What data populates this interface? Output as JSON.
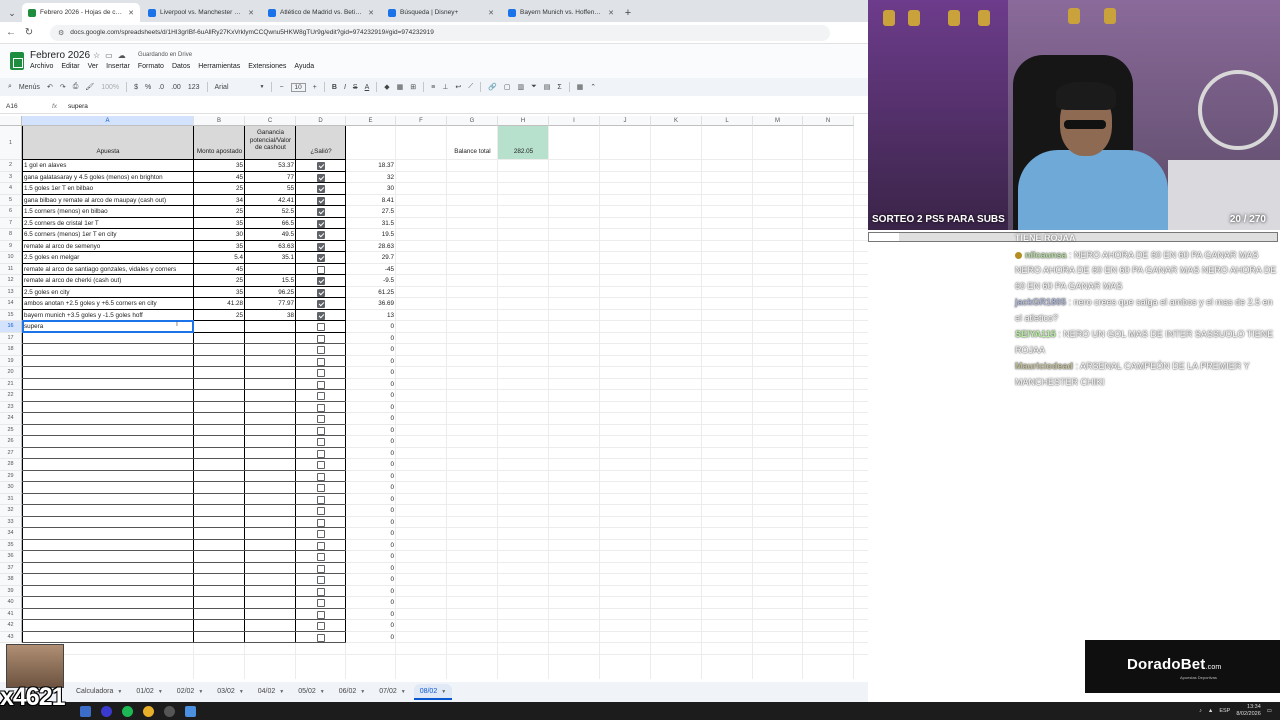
{
  "browser": {
    "tabs": [
      {
        "title": "Febrero 2026 - Hojas de cálcul",
        "active": true,
        "color": "#1e8e3e"
      },
      {
        "title": "Liverpool vs. Manchester City |",
        "active": false,
        "color": "#1a73e8"
      },
      {
        "title": "Atlético de Madrid vs. Betis | D",
        "active": false,
        "color": "#1a73e8"
      },
      {
        "title": "Búsqueda | Disney+",
        "active": false,
        "color": "#1a73e8"
      },
      {
        "title": "Bayern Munich vs. Hoffenheim",
        "active": false,
        "color": "#1a73e8"
      }
    ],
    "url": "docs.google.com/spreadsheets/d/1HI3grIBf-6uAllRy27KxVrklymCCQwnu5HKW8gTUr9g/edit?gid=974232919#gid=974232919"
  },
  "sheets": {
    "title": "Febrero 2026",
    "saved_status": "Guardando en Drive",
    "menu": [
      "Archivo",
      "Editar",
      "Ver",
      "Insertar",
      "Formato",
      "Datos",
      "Herramientas",
      "Extensiones",
      "Ayuda"
    ],
    "toolbar": {
      "menus_label": "Menús",
      "zoom": "100%",
      "currency": "$",
      "percent": "%",
      "decimals_less": ".0",
      "decimals_more": ".00",
      "num_format": "123",
      "font": "Arial",
      "font_size": "10"
    },
    "namebox": "A16",
    "formula": "supera"
  },
  "grid": {
    "columns": [
      "A",
      "B",
      "C",
      "D",
      "E",
      "F",
      "G",
      "H",
      "I",
      "J",
      "K",
      "L",
      "M",
      "N"
    ],
    "header": {
      "apuesta": "Apuesta",
      "monto": "Monto apostado",
      "ganancia": "Ganancia potencial/Valor de cashout",
      "salio": "¿Salió?"
    },
    "balance_label": "Balance total",
    "balance_value": "282.05",
    "rows": [
      {
        "apuesta": "1 gol en alaves",
        "monto": "35",
        "ganancia": "53.37",
        "salio": true,
        "e": "18.37"
      },
      {
        "apuesta": "gana galatasaray y 4.5 goles (menos) en brighton",
        "monto": "45",
        "ganancia": "77",
        "salio": true,
        "e": "32"
      },
      {
        "apuesta": "1.5 goles 1er T en bilbao",
        "monto": "25",
        "ganancia": "55",
        "salio": true,
        "e": "30"
      },
      {
        "apuesta": "gana bilbao y remate al arco de maupay (cash out)",
        "monto": "34",
        "ganancia": "42.41",
        "salio": true,
        "e": "8.41"
      },
      {
        "apuesta": "1.5 corners (menos) en bilbao",
        "monto": "25",
        "ganancia": "52.5",
        "salio": true,
        "e": "27.5"
      },
      {
        "apuesta": "2.5 corners de cristal 1er T",
        "monto": "35",
        "ganancia": "66.5",
        "salio": true,
        "e": "31.5"
      },
      {
        "apuesta": "6.5 corners (menos) 1er T en city",
        "monto": "30",
        "ganancia": "49.5",
        "salio": true,
        "e": "19.5"
      },
      {
        "apuesta": "remate al arco de semenyo",
        "monto": "35",
        "ganancia": "63.63",
        "salio": true,
        "e": "28.63"
      },
      {
        "apuesta": "2.5 goles en melgar",
        "monto": "5.4",
        "ganancia": "35.1",
        "salio": true,
        "e": "29.7"
      },
      {
        "apuesta": "remate al arco de santiago gonzales, vidales y corners",
        "monto": "45",
        "ganancia": "",
        "salio": false,
        "e": "-45"
      },
      {
        "apuesta": "remate al arco de cherki (cash out)",
        "monto": "25",
        "ganancia": "15.5",
        "salio": true,
        "e": "-9.5"
      },
      {
        "apuesta": "2.5 goles en city",
        "monto": "35",
        "ganancia": "96.25",
        "salio": true,
        "e": "61.25"
      },
      {
        "apuesta": "ambos anotan +2.5 goles y +6.5 corners en city",
        "monto": "41.28",
        "ganancia": "77.97",
        "salio": true,
        "e": "36.69"
      },
      {
        "apuesta": "bayern munich +3.5 goles y -1.5 goles hoff",
        "monto": "25",
        "ganancia": "38",
        "salio": true,
        "e": "13"
      },
      {
        "apuesta": "supera",
        "monto": "",
        "ganancia": "",
        "salio": false,
        "e": "0"
      }
    ],
    "empty_row_numbers": [
      "17",
      "18",
      "19",
      "20",
      "21",
      "22",
      "23",
      "24",
      "25",
      "26",
      "27",
      "28",
      "29",
      "30",
      "31",
      "32",
      "33",
      "34",
      "35",
      "36",
      "37",
      "38",
      "39",
      "40",
      "41",
      "42",
      "43"
    ],
    "empty_e_value": "0"
  },
  "sheet_tabs": [
    "Calculadora",
    "01/02",
    "02/02",
    "03/02",
    "04/02",
    "05/02",
    "06/02",
    "07/02",
    "08/02"
  ],
  "active_sheet": "08/02",
  "stream": {
    "sorteo_text": "SORTEO 2 PS5 PARA SUBS",
    "sorteo_count": "20  / 270",
    "sorteo_progress": 0.074,
    "chat": [
      {
        "user": "",
        "text": "TIENE ROJAA"
      },
      {
        "user": "nilcaunsa",
        "text": "NERO AHORA DE 60 EN 60 PA GANAR MAS NERO AHORA DE 60 EN 60 PA GANAR MAS NERO AHORA DE 60 EN 60 PA GANAR MAS"
      },
      {
        "user": "jackGR1805",
        "text": "nero crees que salga el ambos y el mas de 2.5 en el atletico?"
      },
      {
        "user": "SEIYA115",
        "text": "NERO UN GOL MAS DE INTER SASSUOLO TIENE ROJAA"
      },
      {
        "user": "Mauriciodead",
        "text": "ARSENAL CAMPEÓN DE LA PREMIER Y MANCHESTER CHIKI"
      }
    ],
    "chat_colors": {
      "nilcaunsa": "#b5d9a0",
      "jackGR1805": "#b0b8d8",
      "SEIYA115": "#b8f0a0",
      "Mauriciodead": "#c4c09c"
    },
    "sponsor_name": "DoradoBet",
    "sponsor_suffix": ".com",
    "sponsor_sub": "Apuestas Deportivas",
    "counter": "x4621"
  },
  "taskbar": {
    "lang": "ESP",
    "time": "13:34",
    "date": "8/02/2026"
  }
}
